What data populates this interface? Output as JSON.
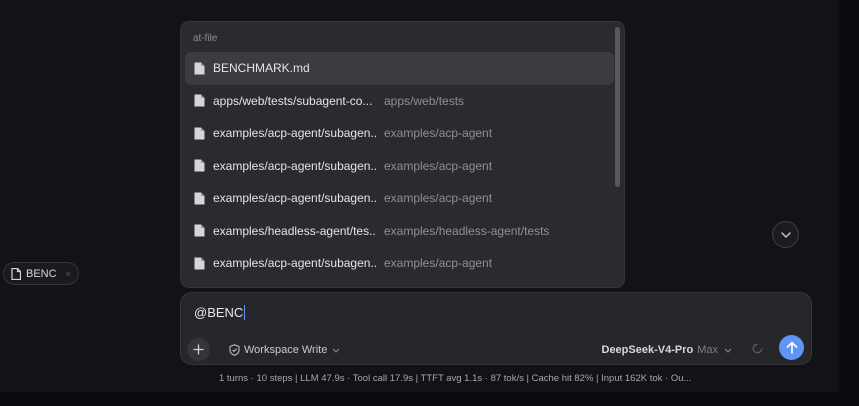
{
  "chip": {
    "label": "BENC",
    "icon": "file-icon",
    "close": "×"
  },
  "popup": {
    "header": "at-file",
    "items": [
      {
        "name": "BENCHMARK.md",
        "path": ""
      },
      {
        "name": "apps/web/tests/subagent-co...",
        "path": "apps/web/tests"
      },
      {
        "name": "examples/acp-agent/subagen...",
        "path": "examples/acp-agent"
      },
      {
        "name": "examples/acp-agent/subagen...",
        "path": "examples/acp-agent"
      },
      {
        "name": "examples/acp-agent/subagen...",
        "path": "examples/acp-agent"
      },
      {
        "name": "examples/headless-agent/tes...",
        "path": "examples/headless-agent/tests"
      },
      {
        "name": "examples/acp-agent/subagen...",
        "path": "examples/acp-agent"
      }
    ],
    "selected_index": 0
  },
  "composer": {
    "input_value": "@BENC",
    "mode_label": "Workspace Write",
    "model_name": "DeepSeek-V4-Pro",
    "model_effort": "Max"
  },
  "status": {
    "text": "1 turns · 10 steps   |   LLM 47.9s · Tool call 17.9s   |   TTFT avg 1.1s · 87 tok/s   |   Cache hit 82%   |   Input 162K tok · Ou..."
  },
  "colors": {
    "background": "#121316",
    "popup": "#2a2b2f",
    "selected_row": "#3b3c41",
    "send_button": "#5f95f5"
  }
}
